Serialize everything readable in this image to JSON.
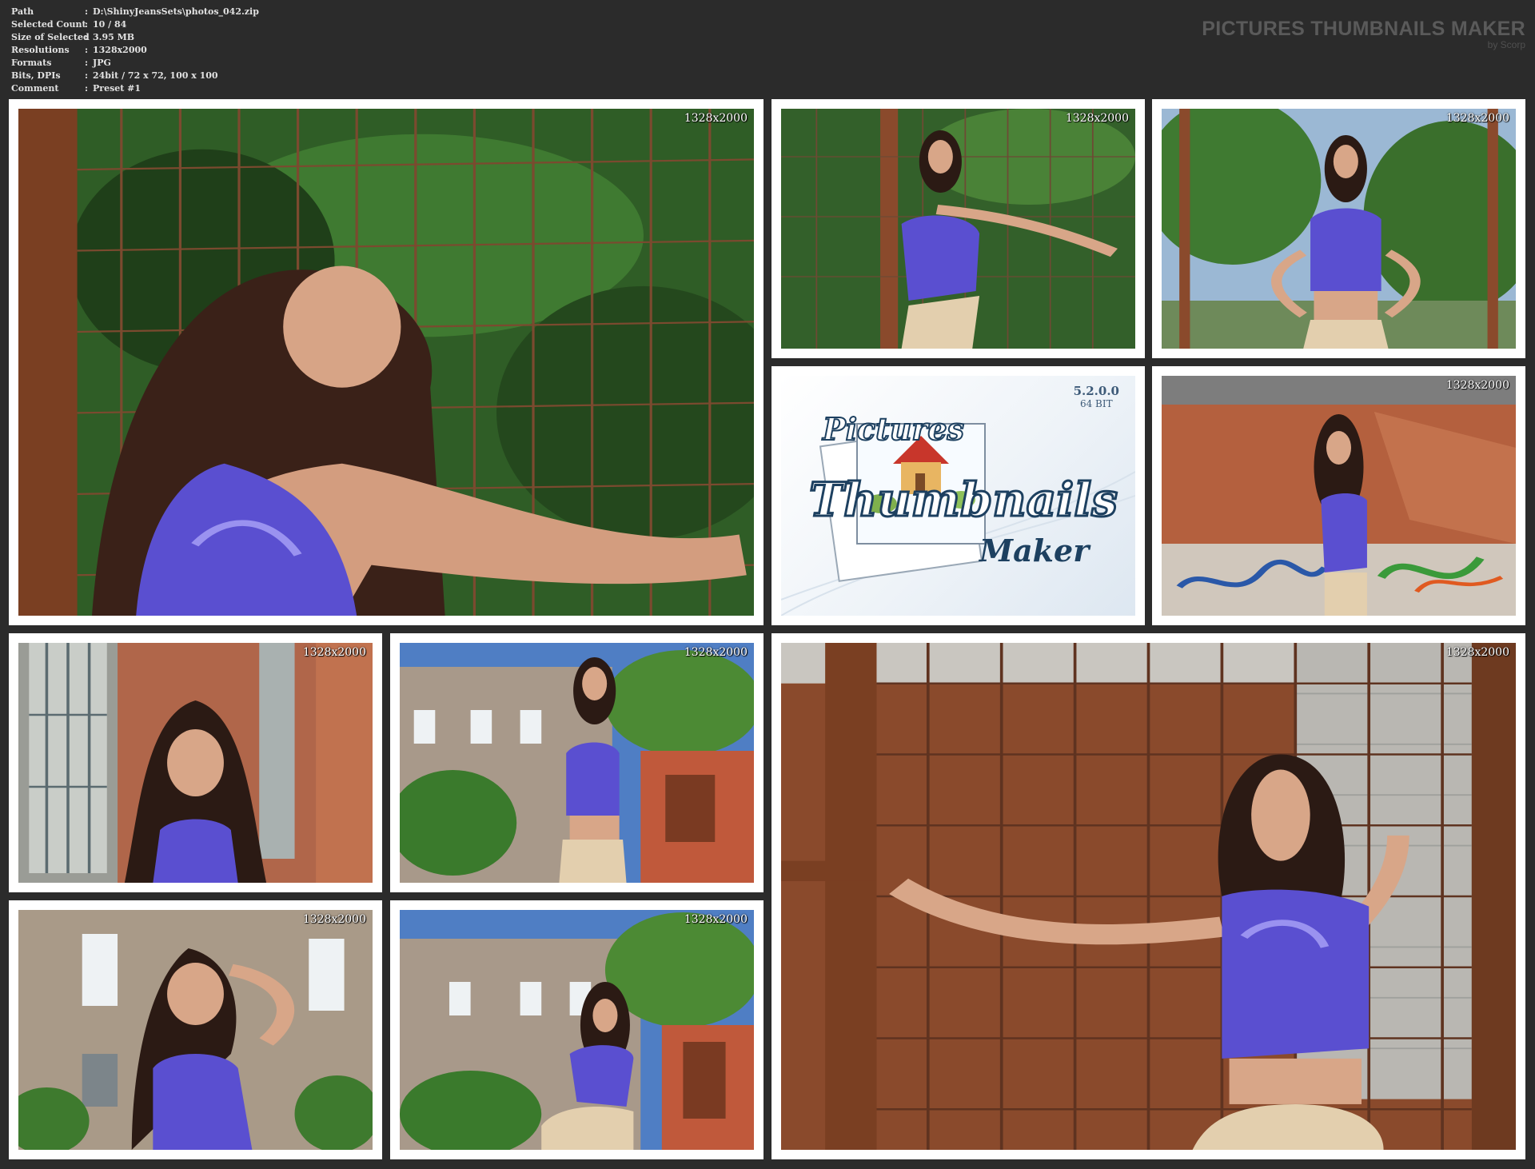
{
  "meta": {
    "separator": ":",
    "rows": [
      {
        "label": "Path",
        "value": "D:\\ShinyJeansSets\\photos_042.zip"
      },
      {
        "label": "Selected Count",
        "value": "10 / 84"
      },
      {
        "label": "Size of Selected",
        "value": "3.95 MB"
      },
      {
        "label": "Resolutions",
        "value": "1328x2000"
      },
      {
        "label": "Formats",
        "value": "JPG"
      },
      {
        "label": "Bits, DPIs",
        "value": "24bit / 72 x 72, 100 x 100"
      },
      {
        "label": "Comment",
        "value": "Preset #1"
      }
    ]
  },
  "brand": {
    "title": "PICTURES THUMBNAILS MAKER",
    "by": "by Scorp"
  },
  "logo": {
    "version": "5.2.0.0",
    "bits": "64 BIT",
    "word1": "Pictures",
    "word2": "Thumbnails",
    "word3": "Maker"
  },
  "thumbnails": [
    {
      "resolution": "1328x2000",
      "scene": "portrait at green fence"
    },
    {
      "resolution": "1328x2000",
      "scene": "leaning on fence"
    },
    {
      "resolution": "1328x2000",
      "scene": "standing, hands on hips, by trees"
    },
    {
      "resolution": "1328x2000",
      "scene": "rusty wall with graffiti"
    },
    {
      "resolution": "1328x2000",
      "scene": "close portrait by window"
    },
    {
      "resolution": "1328x2000",
      "scene": "in front of old building"
    },
    {
      "resolution": "1328x2000",
      "scene": "hand in hair, brick building"
    },
    {
      "resolution": "1328x2000",
      "scene": "crouching near building"
    },
    {
      "resolution": "1328x2000",
      "scene": "arms spread at rusty grid"
    }
  ],
  "colors": {
    "background": "#2b2b2b",
    "tile_border": "#ffffff",
    "top_color": "#5a4fd0",
    "foliage": "#2f5d26",
    "rust": "#8a4a2c"
  }
}
